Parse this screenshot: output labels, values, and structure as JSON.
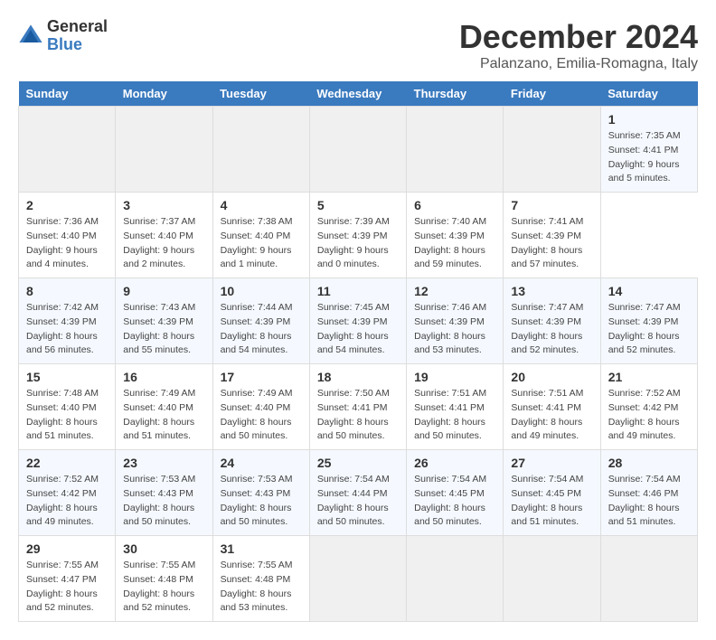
{
  "header": {
    "logo_general": "General",
    "logo_blue": "Blue",
    "title": "December 2024",
    "subtitle": "Palanzano, Emilia-Romagna, Italy"
  },
  "calendar": {
    "days_of_week": [
      "Sunday",
      "Monday",
      "Tuesday",
      "Wednesday",
      "Thursday",
      "Friday",
      "Saturday"
    ],
    "weeks": [
      [
        null,
        null,
        null,
        null,
        null,
        null,
        {
          "day": "1",
          "sunrise": "7:35 AM",
          "sunset": "4:41 PM",
          "daylight": "9 hours and 5 minutes."
        }
      ],
      [
        {
          "day": "2",
          "sunrise": "7:36 AM",
          "sunset": "4:40 PM",
          "daylight": "9 hours and 4 minutes."
        },
        {
          "day": "3",
          "sunrise": "7:37 AM",
          "sunset": "4:40 PM",
          "daylight": "9 hours and 2 minutes."
        },
        {
          "day": "4",
          "sunrise": "7:38 AM",
          "sunset": "4:40 PM",
          "daylight": "9 hours and 1 minute."
        },
        {
          "day": "5",
          "sunrise": "7:39 AM",
          "sunset": "4:39 PM",
          "daylight": "9 hours and 0 minutes."
        },
        {
          "day": "6",
          "sunrise": "7:40 AM",
          "sunset": "4:39 PM",
          "daylight": "8 hours and 59 minutes."
        },
        {
          "day": "7",
          "sunrise": "7:41 AM",
          "sunset": "4:39 PM",
          "daylight": "8 hours and 57 minutes."
        }
      ],
      [
        {
          "day": "8",
          "sunrise": "7:42 AM",
          "sunset": "4:39 PM",
          "daylight": "8 hours and 56 minutes."
        },
        {
          "day": "9",
          "sunrise": "7:43 AM",
          "sunset": "4:39 PM",
          "daylight": "8 hours and 55 minutes."
        },
        {
          "day": "10",
          "sunrise": "7:44 AM",
          "sunset": "4:39 PM",
          "daylight": "8 hours and 54 minutes."
        },
        {
          "day": "11",
          "sunrise": "7:45 AM",
          "sunset": "4:39 PM",
          "daylight": "8 hours and 54 minutes."
        },
        {
          "day": "12",
          "sunrise": "7:46 AM",
          "sunset": "4:39 PM",
          "daylight": "8 hours and 53 minutes."
        },
        {
          "day": "13",
          "sunrise": "7:47 AM",
          "sunset": "4:39 PM",
          "daylight": "8 hours and 52 minutes."
        },
        {
          "day": "14",
          "sunrise": "7:47 AM",
          "sunset": "4:39 PM",
          "daylight": "8 hours and 52 minutes."
        }
      ],
      [
        {
          "day": "15",
          "sunrise": "7:48 AM",
          "sunset": "4:40 PM",
          "daylight": "8 hours and 51 minutes."
        },
        {
          "day": "16",
          "sunrise": "7:49 AM",
          "sunset": "4:40 PM",
          "daylight": "8 hours and 51 minutes."
        },
        {
          "day": "17",
          "sunrise": "7:49 AM",
          "sunset": "4:40 PM",
          "daylight": "8 hours and 50 minutes."
        },
        {
          "day": "18",
          "sunrise": "7:50 AM",
          "sunset": "4:41 PM",
          "daylight": "8 hours and 50 minutes."
        },
        {
          "day": "19",
          "sunrise": "7:51 AM",
          "sunset": "4:41 PM",
          "daylight": "8 hours and 50 minutes."
        },
        {
          "day": "20",
          "sunrise": "7:51 AM",
          "sunset": "4:41 PM",
          "daylight": "8 hours and 49 minutes."
        },
        {
          "day": "21",
          "sunrise": "7:52 AM",
          "sunset": "4:42 PM",
          "daylight": "8 hours and 49 minutes."
        }
      ],
      [
        {
          "day": "22",
          "sunrise": "7:52 AM",
          "sunset": "4:42 PM",
          "daylight": "8 hours and 49 minutes."
        },
        {
          "day": "23",
          "sunrise": "7:53 AM",
          "sunset": "4:43 PM",
          "daylight": "8 hours and 50 minutes."
        },
        {
          "day": "24",
          "sunrise": "7:53 AM",
          "sunset": "4:43 PM",
          "daylight": "8 hours and 50 minutes."
        },
        {
          "day": "25",
          "sunrise": "7:54 AM",
          "sunset": "4:44 PM",
          "daylight": "8 hours and 50 minutes."
        },
        {
          "day": "26",
          "sunrise": "7:54 AM",
          "sunset": "4:45 PM",
          "daylight": "8 hours and 50 minutes."
        },
        {
          "day": "27",
          "sunrise": "7:54 AM",
          "sunset": "4:45 PM",
          "daylight": "8 hours and 51 minutes."
        },
        {
          "day": "28",
          "sunrise": "7:54 AM",
          "sunset": "4:46 PM",
          "daylight": "8 hours and 51 minutes."
        }
      ],
      [
        {
          "day": "29",
          "sunrise": "7:55 AM",
          "sunset": "4:47 PM",
          "daylight": "8 hours and 52 minutes."
        },
        {
          "day": "30",
          "sunrise": "7:55 AM",
          "sunset": "4:48 PM",
          "daylight": "8 hours and 52 minutes."
        },
        {
          "day": "31",
          "sunrise": "7:55 AM",
          "sunset": "4:48 PM",
          "daylight": "8 hours and 53 minutes."
        },
        null,
        null,
        null,
        null
      ]
    ]
  }
}
